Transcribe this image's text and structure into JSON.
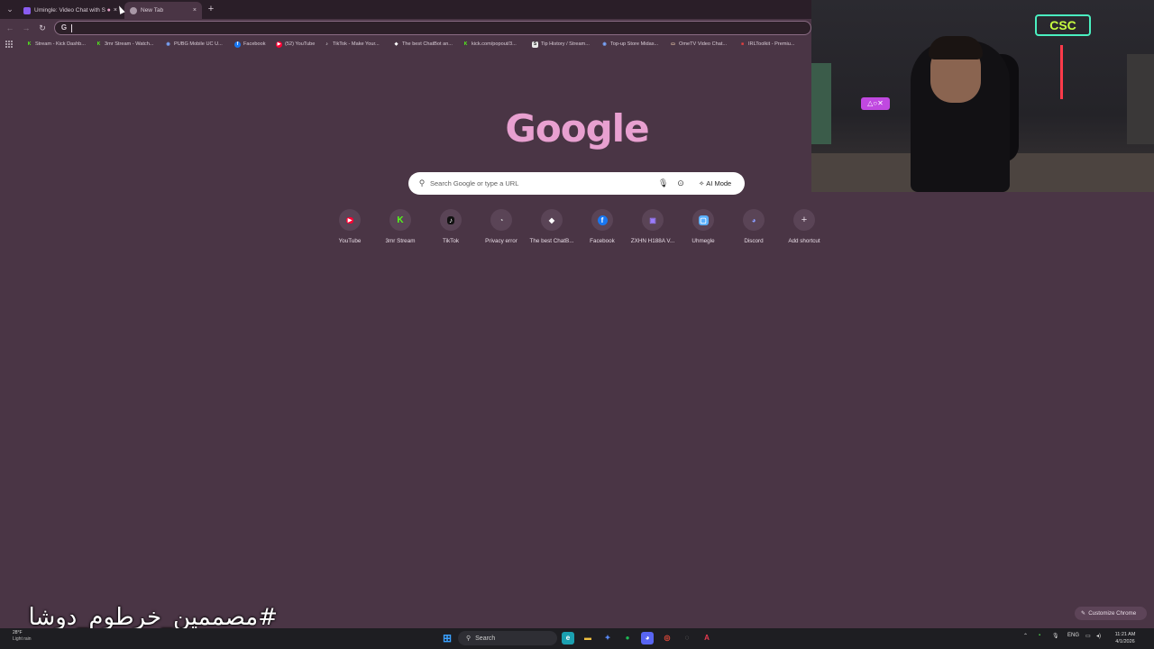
{
  "tabs": [
    {
      "title": "Umingle: Video Chat with S",
      "favicon_color": "#8a5cf0",
      "close": "×",
      "audio_icon": "●"
    },
    {
      "title": "New Tab",
      "favicon_color": "#a898a6",
      "close": "×"
    }
  ],
  "new_tab": "+",
  "tab_menu": "⌄",
  "toolbar": {
    "back": "←",
    "forward": "→",
    "reload": "↻",
    "omnibox_icon": "G",
    "omnibox_value": ""
  },
  "bookmarks": [
    {
      "label": "Stream - Kick Dashb...",
      "icon": "K",
      "color": "#53fc18"
    },
    {
      "label": "3mr Stream - Watch...",
      "icon": "K",
      "color": "#53fc18"
    },
    {
      "label": "PUBG Mobile UC U...",
      "icon": "◉",
      "color": "#7aa8ff"
    },
    {
      "label": "Facebook",
      "icon": "f",
      "color": "#1877f2"
    },
    {
      "label": "(52) YouTube",
      "icon": "▶",
      "color": "#ff0033"
    },
    {
      "label": "TikTok - Make Your...",
      "icon": "♪",
      "color": "#222222"
    },
    {
      "label": "The best ChatBot an...",
      "icon": "◆",
      "color": "#ffffff"
    },
    {
      "label": "kick.com/popout/3...",
      "icon": "K",
      "color": "#53fc18"
    },
    {
      "label": "Tip History / Stream...",
      "icon": "S",
      "color": "#e8e8e8"
    },
    {
      "label": "Top-up Store Midas...",
      "icon": "◉",
      "color": "#7aa8ff"
    },
    {
      "label": "OmeTV Video Chat...",
      "icon": "▭",
      "color": "#f0d0b0"
    },
    {
      "label": "IRLToolkit - Premiu...",
      "icon": "■",
      "color": "#e84040"
    }
  ],
  "logo": "Google",
  "search": {
    "placeholder": "Search Google or type a URL",
    "ai_mode": "AI Mode",
    "search_icon": "⚲",
    "mic_icon": "🎙",
    "lens_icon": "⊙",
    "ai_icon": "✧"
  },
  "shortcuts": [
    {
      "label": "YouTube",
      "icon": "▶",
      "color": "#ff0033"
    },
    {
      "label": "3mr Stream",
      "icon": "K",
      "color": "#53fc18"
    },
    {
      "label": "TikTok",
      "icon": "♪",
      "color": "#ffffff"
    },
    {
      "label": "Privacy error",
      "icon": "◔",
      "color": "#cccccc"
    },
    {
      "label": "The best ChatB...",
      "icon": "◆",
      "color": "#ffffff"
    },
    {
      "label": "Facebook",
      "icon": "f",
      "color": "#3b8bff"
    },
    {
      "label": "ZXHN H188A V...",
      "icon": "▣",
      "color": "#9a7cff"
    },
    {
      "label": "Uhmegle",
      "icon": "▢",
      "color": "#5ab0ff"
    },
    {
      "label": "Discord",
      "icon": "◕",
      "color": "#8a9cff"
    },
    {
      "label": "Add shortcut",
      "icon": "+",
      "color": "#e8dce6"
    }
  ],
  "customize": {
    "label": "Customize Chrome",
    "icon": "✎"
  },
  "hashtag": "#مصممين_خرطوم_دوشا",
  "weather": {
    "temp": "28°F",
    "desc": "Light rain"
  },
  "taskbar": {
    "search_label": "Search",
    "language": "ENG",
    "time": "11:21 AM",
    "date": "4/1/2026",
    "apps": [
      {
        "name": "windows",
        "icon": "⊞",
        "color": "#3aa0ff"
      },
      {
        "name": "edge",
        "icon": "e",
        "color": "#1ba0b0"
      },
      {
        "name": "explorer",
        "icon": "▬",
        "color": "#f0c040"
      },
      {
        "name": "copilot",
        "icon": "✦",
        "color": "#5a8cff"
      },
      {
        "name": "spotify",
        "icon": "●",
        "color": "#1db954"
      },
      {
        "name": "discord",
        "icon": "◕",
        "color": "#5865f2"
      },
      {
        "name": "chrome",
        "icon": "◎",
        "color": "#e84a3a"
      },
      {
        "name": "obs",
        "icon": "◌",
        "color": "#888888"
      },
      {
        "name": "app",
        "icon": "A",
        "color": "#e83a50"
      }
    ]
  },
  "webcam": {
    "neon_sign": "CSC"
  }
}
